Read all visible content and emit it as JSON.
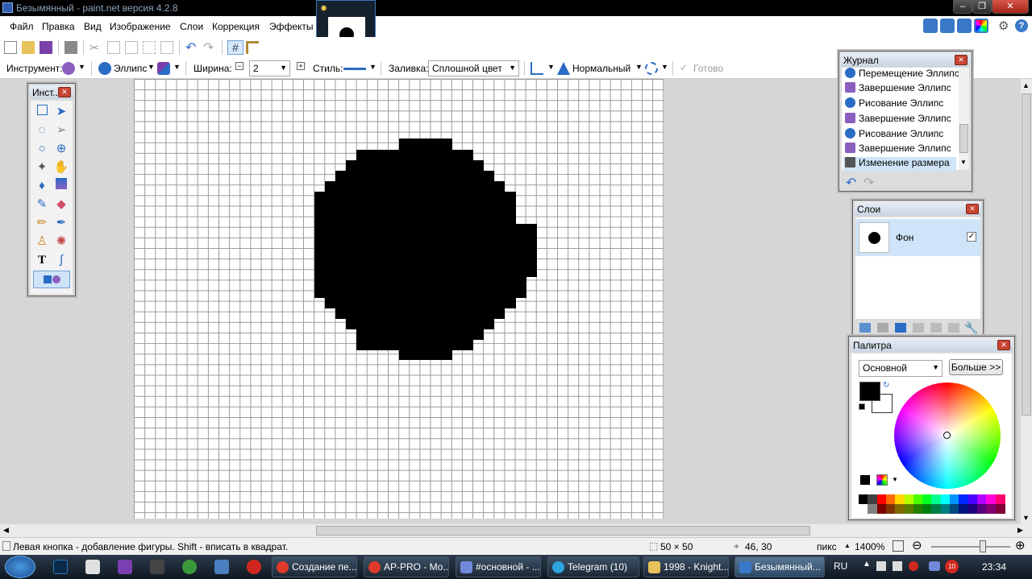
{
  "window": {
    "title": "Безымянный - paint.net версия 4.2.8"
  },
  "menu": [
    "Файл",
    "Правка",
    "Вид",
    "Изображение",
    "Слои",
    "Коррекция",
    "Эффекты"
  ],
  "toolbar": {
    "tool_label": "Инструмент:",
    "shape": "Эллипс",
    "width_label": "Ширина:",
    "width_value": "2",
    "style_label": "Стиль:",
    "fill_label": "Заливка:",
    "fill_value": "Сплошной цвет",
    "blend_mode": "Нормальный",
    "finish": "Готово"
  },
  "tools_window": {
    "title": "Инст..."
  },
  "history": {
    "title": "Журнал",
    "items": [
      "Перемещение Эллипс",
      "Завершение Эллипс",
      "Рисование Эллипс",
      "Завершение Эллипс",
      "Рисование Эллипс",
      "Завершение Эллипс",
      "Изменение размера"
    ],
    "selected_index": 6
  },
  "layers": {
    "title": "Слои",
    "layer_name": "Фон",
    "visible": true
  },
  "palette": {
    "title": "Палитра",
    "mode": "Основной",
    "more_button": "Больше >>",
    "primary_color": "#000000",
    "secondary_color": "#ffffff",
    "swatches_top": [
      "#000000",
      "#404040",
      "#ff0000",
      "#ff6a00",
      "#ffd800",
      "#b6ff00",
      "#4cff00",
      "#00ff21",
      "#00ff90",
      "#00ffff",
      "#0094ff",
      "#0026ff",
      "#4800ff",
      "#b200ff",
      "#ff00dc",
      "#ff006e"
    ],
    "swatches_bottom": [
      "#ffffff",
      "#808080",
      "#7f0000",
      "#7f3300",
      "#7f6a00",
      "#5b7f00",
      "#267f00",
      "#007f0e",
      "#007f46",
      "#007f7f",
      "#004a7f",
      "#00137f",
      "#21007f",
      "#57007f",
      "#7f006e",
      "#7f0037"
    ]
  },
  "status": {
    "hint": "Левая кнопка - добавление фигуры. Shift - вписать в квадрат.",
    "image_size": "50 × 50",
    "cursor_pos": "46, 30",
    "units": "пикс",
    "zoom": "1400%"
  },
  "taskbar": {
    "tasks": [
      "Создание пе...",
      "AP-PRO - Mo...",
      "#основной - ...",
      "Telegram (10)",
      "1998 - Knight...",
      "Безымянный..."
    ],
    "lang": "RU",
    "time": "23:34",
    "badge": "10"
  },
  "colors": {
    "accent": "#2b6cc4",
    "selection": "#cfe4f8"
  }
}
